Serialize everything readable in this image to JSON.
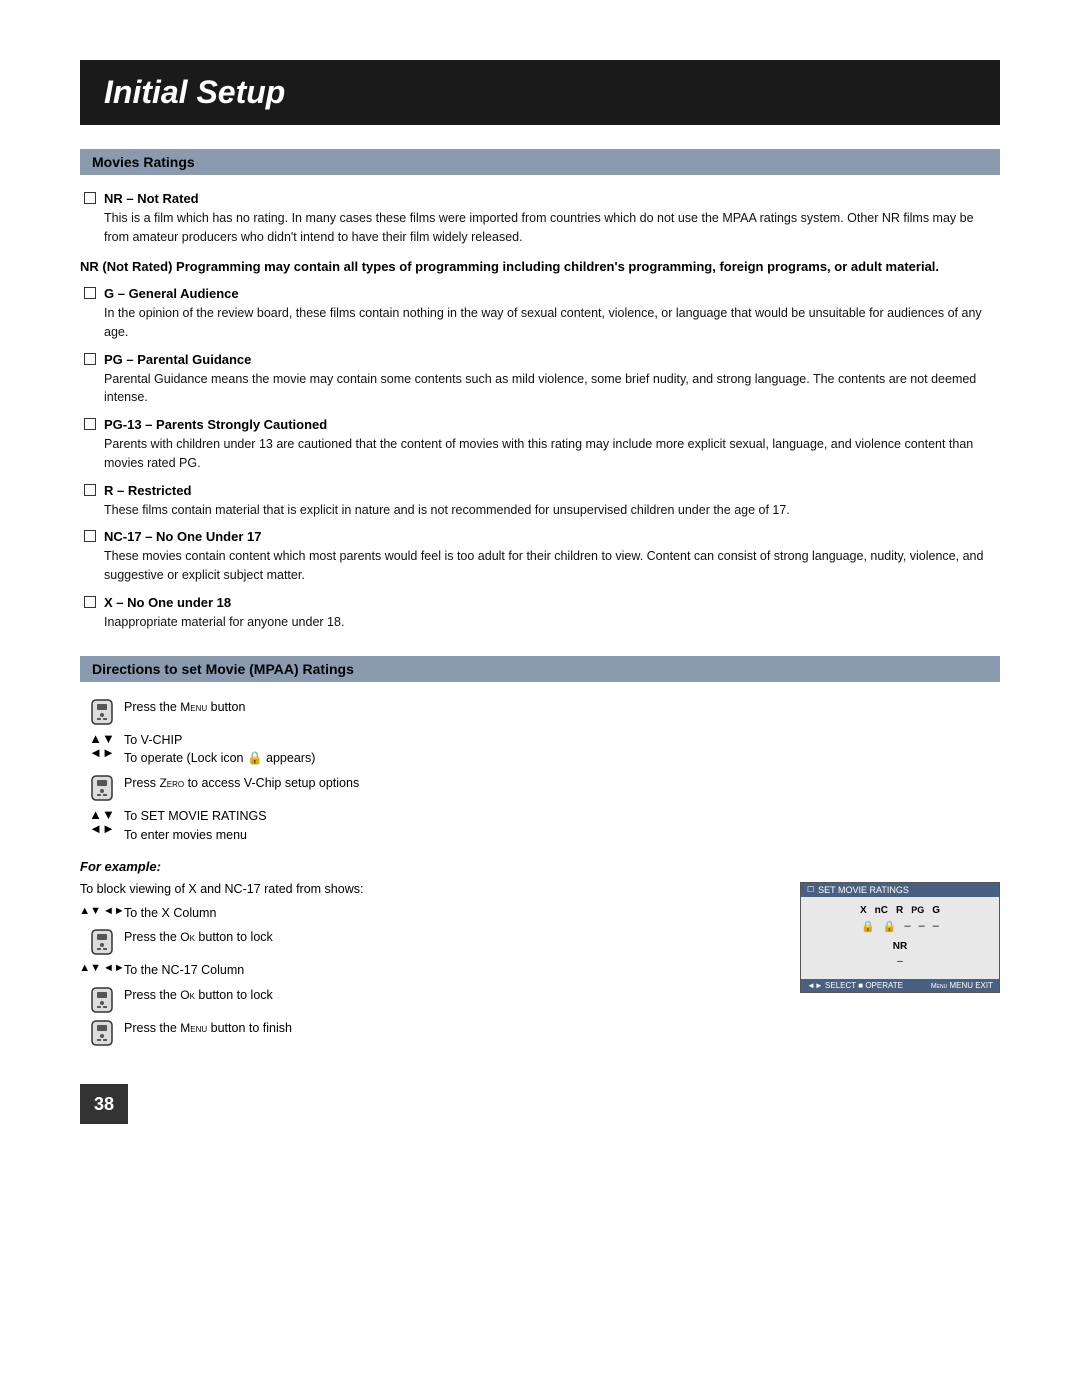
{
  "page": {
    "title": "Initial Setup",
    "page_number": "38"
  },
  "movies_ratings": {
    "section_title": "Movies Ratings",
    "ratings": [
      {
        "id": "nr",
        "title": "NR – Not Rated",
        "description": "This is a film which has no rating. In many cases these films were imported from countries which do not use the MPAA ratings system. Other NR films may be from amateur producers who didn't intend to have their film widely released."
      },
      {
        "id": "bold_note",
        "text": "NR (Not Rated) Programming may contain all types of programming including children's programming, foreign programs, or adult material."
      },
      {
        "id": "g",
        "title": "G – General Audience",
        "description": "In the opinion of the review board, these films contain nothing in the way of sexual content, violence, or language that would be unsuitable for audiences of any age."
      },
      {
        "id": "pg",
        "title": "PG – Parental Guidance",
        "description": "Parental Guidance means the movie may contain some contents such as mild violence, some brief nudity, and strong language. The contents are not deemed intense."
      },
      {
        "id": "pg13",
        "title": "PG-13 – Parents Strongly Cautioned",
        "description": "Parents with children under 13 are cautioned that the content of movies with this rating may include more explicit sexual, language, and violence content than movies rated PG."
      },
      {
        "id": "r",
        "title": "R – Restricted",
        "description": "These films contain material that is explicit in nature and is not recommended for unsupervised children under the age of 17."
      },
      {
        "id": "nc17",
        "title": "NC-17 – No One Under 17",
        "description": "These movies contain content which most parents would feel is too adult for their children to view. Content can consist of strong language, nudity, violence, and suggestive or explicit subject matter."
      },
      {
        "id": "x",
        "title": "X – No One under 18",
        "description": "Inappropriate material for anyone under 18."
      }
    ]
  },
  "directions": {
    "section_title": "Directions to set Movie (MPAA) Ratings",
    "steps": [
      {
        "icon": "remote",
        "text": "Press the MENU button"
      },
      {
        "icon": "arrows-ud-lr",
        "text": "To V-CHIP\nTo operate (Lock icon 🔒 appears)"
      },
      {
        "icon": "remote",
        "text": "Press ZERO to access V-Chip setup options"
      },
      {
        "icon": "arrows-ud-lr",
        "text": "To SET MOVIE RATINGS\nTo enter movies menu"
      }
    ],
    "for_example_label": "For example:",
    "for_example_intro": "To block viewing of X and NC-17 rated from shows:",
    "example_steps": [
      {
        "icon": "arrows-ud-lr-combo",
        "text": "To the X Column"
      },
      {
        "icon": "remote",
        "text": "Press the Ok button to lock"
      },
      {
        "icon": "arrows-ud-lr-combo",
        "text": "To the NC-17 Column"
      },
      {
        "icon": "remote",
        "text": "Press the Ok button to lock"
      },
      {
        "icon": "remote",
        "text": "Press the MENU button to finish"
      }
    ]
  },
  "screen": {
    "title": "SET MOVIE RATINGS",
    "ratings_row": [
      "X",
      "nC",
      "R",
      "PG",
      "G"
    ],
    "icons_row": [
      "🔒",
      "🔒",
      "–",
      "–",
      "–"
    ],
    "nr_label": "NR",
    "nr_dash": "–",
    "bottom_left": "◄► SELECT  ■ OPERATE",
    "bottom_right": "MENU EXIT"
  }
}
